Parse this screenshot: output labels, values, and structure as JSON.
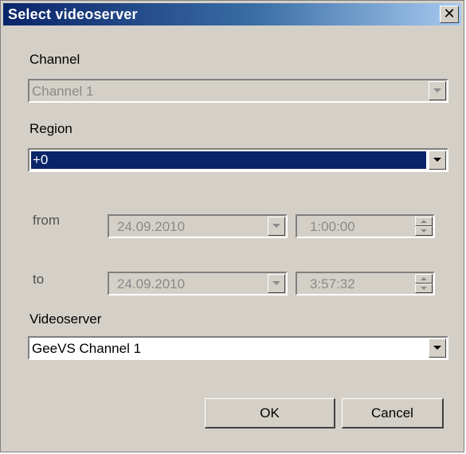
{
  "window": {
    "title": "Select videoserver",
    "close_label": "✕"
  },
  "channel": {
    "label": "Channel",
    "value": "Channel 1"
  },
  "region": {
    "label": "Region",
    "value": "+0"
  },
  "from": {
    "label": "from",
    "date": "24.09.2010",
    "time": "1:00:00"
  },
  "to": {
    "label": "to",
    "date": "24.09.2010",
    "time": "3:57:32"
  },
  "videoserver": {
    "label": "Videoserver",
    "value": "GeeVS Channel 1"
  },
  "buttons": {
    "ok": "OK",
    "cancel": "Cancel"
  },
  "colors": {
    "dialog_bg": "#d4d0c8",
    "selection": "#0a246a",
    "title_gradient_start": "#0a246a",
    "title_gradient_end": "#a6caf0"
  }
}
